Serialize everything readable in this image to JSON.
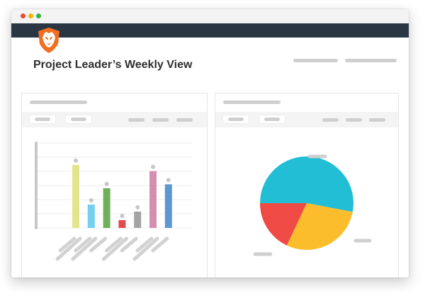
{
  "header": {
    "title": "Project Leader’s Weekly View",
    "logo": "lion-logo-icon"
  },
  "window": {
    "controls": [
      "close-dot",
      "minimize-dot",
      "maximize-dot"
    ],
    "colors": {
      "close": "#e8493c",
      "minimize": "#f4b400",
      "maximize": "#30b54a",
      "navbar": "#2b3644",
      "logo": "#f26f21"
    }
  },
  "chart_data": [
    {
      "type": "bar",
      "categories": [
        "",
        "",
        "",
        "",
        "",
        "",
        ""
      ],
      "values": [
        81,
        30,
        51,
        10,
        21,
        73,
        56
      ],
      "ylim": [
        0,
        100
      ],
      "grid": true,
      "colors": [
        "#e3e58c",
        "#75cff0",
        "#6fb05c",
        "#e14b4b",
        "#a4a4a4",
        "#d48fae",
        "#5b97d3"
      ]
    },
    {
      "type": "pie",
      "values": [
        53,
        29,
        18
      ],
      "colors": [
        "#21bed5",
        "#fbbd2c",
        "#ef4a43"
      ]
    }
  ]
}
